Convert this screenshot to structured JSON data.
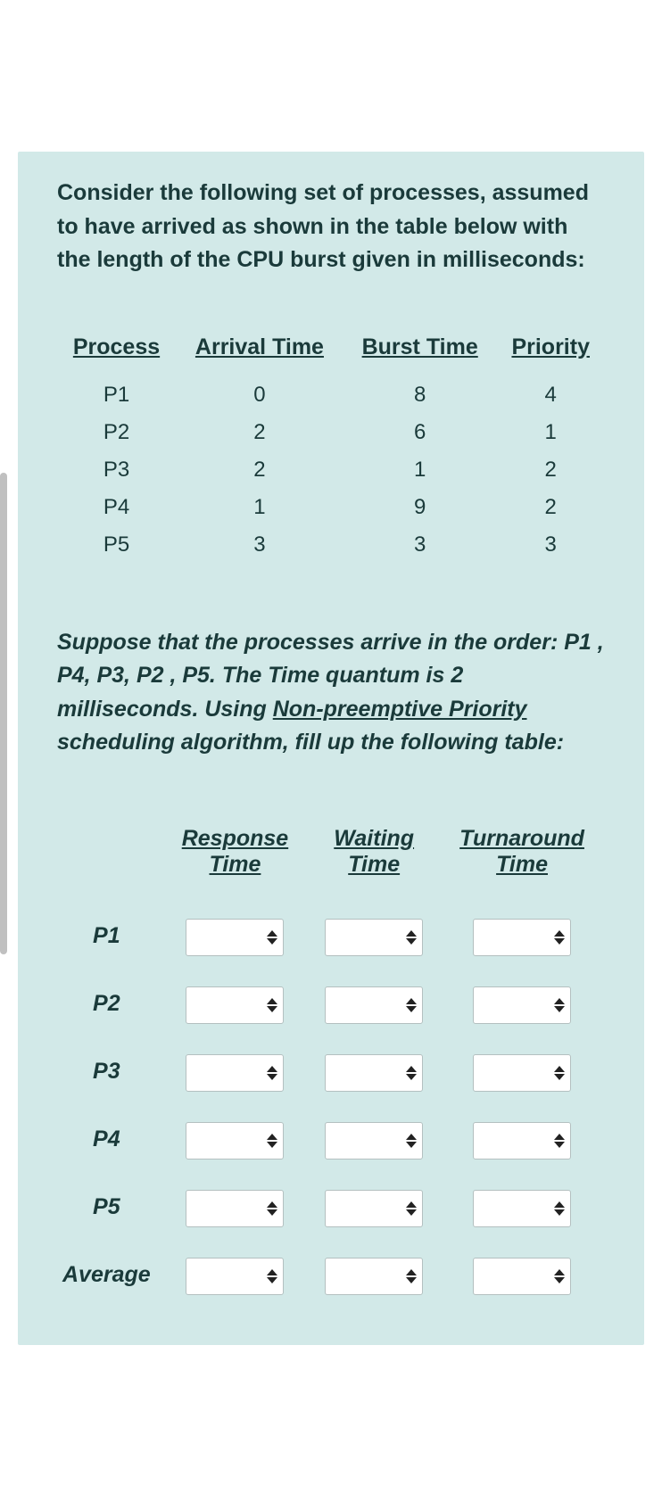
{
  "intro": "Consider the following set of processes, assumed to have arrived as shown in the table below with the length of the CPU burst given in milliseconds:",
  "process_table": {
    "headers": [
      "Process",
      "Arrival Time",
      "Burst Time",
      "Priority"
    ],
    "rows": [
      {
        "process": "P1",
        "arrival": "0",
        "burst": "8",
        "priority": "4"
      },
      {
        "process": "P2",
        "arrival": "2",
        "burst": "6",
        "priority": "1"
      },
      {
        "process": "P3",
        "arrival": "2",
        "burst": "1",
        "priority": "2"
      },
      {
        "process": "P4",
        "arrival": "1",
        "burst": "9",
        "priority": "2"
      },
      {
        "process": "P5",
        "arrival": "3",
        "burst": "3",
        "priority": "3"
      }
    ]
  },
  "instruction": {
    "part1": "Suppose that the processes arrive in the order: P1 , P4, P3, P2 , P5. The Time quantum is 2 milliseconds. Using ",
    "underlined": "Non-preemptive Priority",
    "part2": " scheduling algorithm, fill up the following table:"
  },
  "answer_table": {
    "headers": [
      "",
      "Response Time",
      "Waiting Time",
      "Turnaround Time"
    ],
    "row_labels": [
      "P1",
      "P2",
      "P3",
      "P4",
      "P5",
      "Average"
    ]
  }
}
